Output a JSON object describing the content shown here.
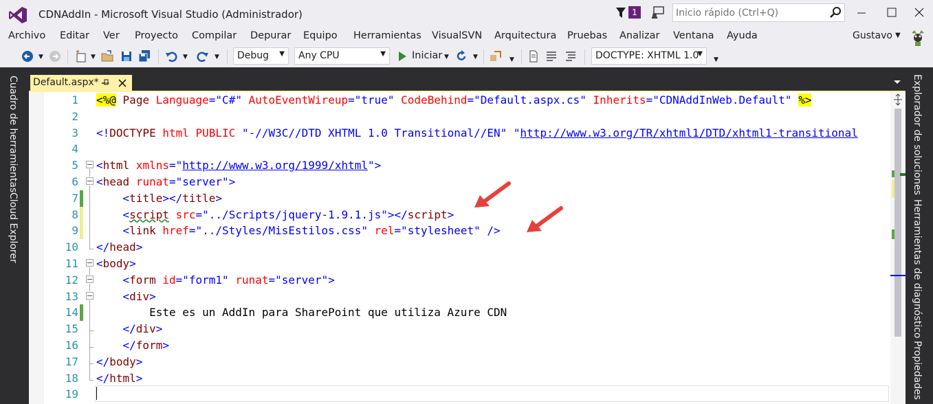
{
  "window": {
    "title": "CDNAddIn - Microsoft Visual Studio (Administrador)",
    "notification_count": "1",
    "quick_launch_placeholder": "Inicio rápido (Ctrl+Q)"
  },
  "menu": {
    "items": [
      "Archivo",
      "Editar",
      "Ver",
      "Proyecto",
      "Compilar",
      "Depurar",
      "Equipo",
      "Herramientas",
      "VisualSVN",
      "Arquitectura",
      "Pruebas",
      "Analizar",
      "Ventana",
      "Ayuda"
    ],
    "user": "Gustavo"
  },
  "toolbar": {
    "configuration": "Debug",
    "platform": "Any CPU",
    "run_label": "Iniciar",
    "doctype": "DOCTYPE: XHTML 1.0"
  },
  "left_panel": {
    "tabs": [
      "Cuadro de herramientas",
      "Cloud Explorer"
    ]
  },
  "right_panel": {
    "tabs": [
      "Explorador de soluciones",
      "Herramientas de diagnóstico",
      "Propiedades"
    ]
  },
  "document_tab": {
    "label": "Default.aspx*"
  },
  "editor": {
    "line_numbers": [
      "1",
      "2",
      "3",
      "4",
      "5",
      "6",
      "7",
      "8",
      "9",
      "10",
      "11",
      "12",
      "13",
      "14",
      "15",
      "16",
      "17",
      "18",
      "19"
    ],
    "lines": [
      [
        [
          "hl",
          "<%@"
        ],
        [
          "t",
          " "
        ],
        [
          "m",
          "Page"
        ],
        [
          "t",
          " "
        ],
        [
          "r",
          "Language"
        ],
        [
          "b",
          "="
        ],
        [
          "s",
          "\"C#\""
        ],
        [
          "t",
          " "
        ],
        [
          "r",
          "AutoEventWireup"
        ],
        [
          "b",
          "="
        ],
        [
          "s",
          "\"true\""
        ],
        [
          "t",
          " "
        ],
        [
          "r",
          "CodeBehind"
        ],
        [
          "b",
          "="
        ],
        [
          "s",
          "\"Default.aspx.cs\""
        ],
        [
          "t",
          " "
        ],
        [
          "r",
          "Inherits"
        ],
        [
          "b",
          "="
        ],
        [
          "s",
          "\"CDNAddInWeb.Default\""
        ],
        [
          "t",
          " "
        ],
        [
          "hl",
          "%>"
        ]
      ],
      [],
      [
        [
          "b",
          "<!"
        ],
        [
          "m",
          "DOCTYPE"
        ],
        [
          "t",
          " "
        ],
        [
          "r",
          "html"
        ],
        [
          "t",
          " "
        ],
        [
          "r",
          "PUBLIC"
        ],
        [
          "t",
          " "
        ],
        [
          "s",
          "\"-//W3C//DTD XHTML 1.0 Transitional//EN\""
        ],
        [
          "t",
          " "
        ],
        [
          "s",
          "\""
        ],
        [
          "u",
          "http://www.w3.org/TR/xhtml1/DTD/xhtml1-transitional"
        ]
      ],
      [],
      [
        [
          "b",
          "<"
        ],
        [
          "m",
          "html"
        ],
        [
          "t",
          " "
        ],
        [
          "r",
          "xmlns"
        ],
        [
          "b",
          "="
        ],
        [
          "s",
          "\""
        ],
        [
          "u",
          "http://www.w3.org/1999/xhtml"
        ],
        [
          "s",
          "\""
        ],
        [
          "b",
          ">"
        ]
      ],
      [
        [
          "b",
          "<"
        ],
        [
          "m",
          "head"
        ],
        [
          "t",
          " "
        ],
        [
          "r",
          "runat"
        ],
        [
          "b",
          "="
        ],
        [
          "s",
          "\"server\""
        ],
        [
          "b",
          ">"
        ]
      ],
      [
        [
          "t",
          "    "
        ],
        [
          "b",
          "<"
        ],
        [
          "m",
          "title"
        ],
        [
          "b",
          "></"
        ],
        [
          "m",
          "title"
        ],
        [
          "b",
          ">"
        ]
      ],
      [
        [
          "t",
          "    "
        ],
        [
          "b",
          "<"
        ],
        [
          "mw",
          "script"
        ],
        [
          "t",
          " "
        ],
        [
          "r",
          "src"
        ],
        [
          "b",
          "="
        ],
        [
          "s",
          "\"../Scripts/jquery-1.9.1.js\""
        ],
        [
          "b",
          "></"
        ],
        [
          "m",
          "script"
        ],
        [
          "b",
          ">"
        ]
      ],
      [
        [
          "t",
          "    "
        ],
        [
          "b",
          "<"
        ],
        [
          "m",
          "link"
        ],
        [
          "t",
          " "
        ],
        [
          "r",
          "href"
        ],
        [
          "b",
          "="
        ],
        [
          "s",
          "\"../Styles/MisEstilos.css\""
        ],
        [
          "t",
          " "
        ],
        [
          "r",
          "rel"
        ],
        [
          "b",
          "="
        ],
        [
          "s",
          "\"stylesheet\""
        ],
        [
          "t",
          " "
        ],
        [
          "b",
          "/>"
        ]
      ],
      [
        [
          "b",
          "</"
        ],
        [
          "m",
          "head"
        ],
        [
          "b",
          ">"
        ]
      ],
      [
        [
          "b",
          "<"
        ],
        [
          "m",
          "body"
        ],
        [
          "b",
          ">"
        ]
      ],
      [
        [
          "t",
          "    "
        ],
        [
          "b",
          "<"
        ],
        [
          "m",
          "form"
        ],
        [
          "t",
          " "
        ],
        [
          "r",
          "id"
        ],
        [
          "b",
          "="
        ],
        [
          "s",
          "\"form1\""
        ],
        [
          "t",
          " "
        ],
        [
          "r",
          "runat"
        ],
        [
          "b",
          "="
        ],
        [
          "s",
          "\"server\""
        ],
        [
          "b",
          ">"
        ]
      ],
      [
        [
          "t",
          "    "
        ],
        [
          "b",
          "<"
        ],
        [
          "m",
          "div"
        ],
        [
          "b",
          ">"
        ]
      ],
      [
        [
          "t",
          "        Este es un AddIn para SharePoint que utiliza Azure CDN"
        ]
      ],
      [
        [
          "t",
          "    "
        ],
        [
          "b",
          "</"
        ],
        [
          "m",
          "div"
        ],
        [
          "b",
          ">"
        ]
      ],
      [
        [
          "t",
          "    "
        ],
        [
          "b",
          "</"
        ],
        [
          "m",
          "form"
        ],
        [
          "b",
          ">"
        ]
      ],
      [
        [
          "b",
          "</"
        ],
        [
          "m",
          "body"
        ],
        [
          "b",
          ">"
        ]
      ],
      [
        [
          "b",
          "</"
        ],
        [
          "m",
          "html"
        ],
        [
          "b",
          ">"
        ]
      ],
      []
    ]
  },
  "colors": {
    "accent": "#68217a",
    "tab_active": "#fff1a8",
    "panel_dark": "#2d2d30",
    "change_saved": "#57a64a",
    "change_unsaved": "#efef91",
    "arrow": "#e8403a"
  },
  "icons": [
    "vs-logo-icon",
    "filter-icon",
    "feedback-icon",
    "search-icon",
    "minimize-icon",
    "maximize-icon",
    "close-icon",
    "back-icon",
    "forward-icon",
    "new-project-icon",
    "open-file-icon",
    "save-icon",
    "save-all-icon",
    "undo-icon",
    "redo-icon",
    "start-icon",
    "refresh-icon",
    "pin-icon",
    "split-icon"
  ]
}
